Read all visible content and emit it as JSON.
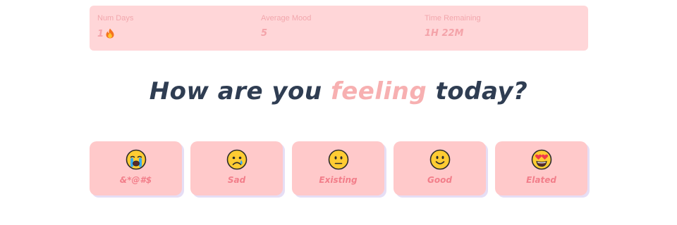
{
  "stats": {
    "num_days": {
      "label": "Num Days",
      "value": "1",
      "icon": "fire-icon"
    },
    "average_mood": {
      "label": "Average Mood",
      "value": "5"
    },
    "time_remaining": {
      "label": "Time Remaining",
      "value": "1H 22M"
    }
  },
  "heading": {
    "before": "How are you ",
    "accent": "feeling",
    "after": " today?"
  },
  "moods": [
    {
      "label": "&*@#$",
      "icon": "crying-face-icon"
    },
    {
      "label": "Sad",
      "icon": "sad-face-icon"
    },
    {
      "label": "Existing",
      "icon": "neutral-face-icon"
    },
    {
      "label": "Good",
      "icon": "smiling-face-icon"
    },
    {
      "label": "Elated",
      "icon": "heart-eyes-face-icon"
    }
  ],
  "colors": {
    "stats_background": "#ffd6d8",
    "card_background": "#ffc9ca",
    "heading": "#2f3d52",
    "accent": "#f7b0b1",
    "mood_label": "#f27e8a",
    "face": "#ffcc33"
  }
}
